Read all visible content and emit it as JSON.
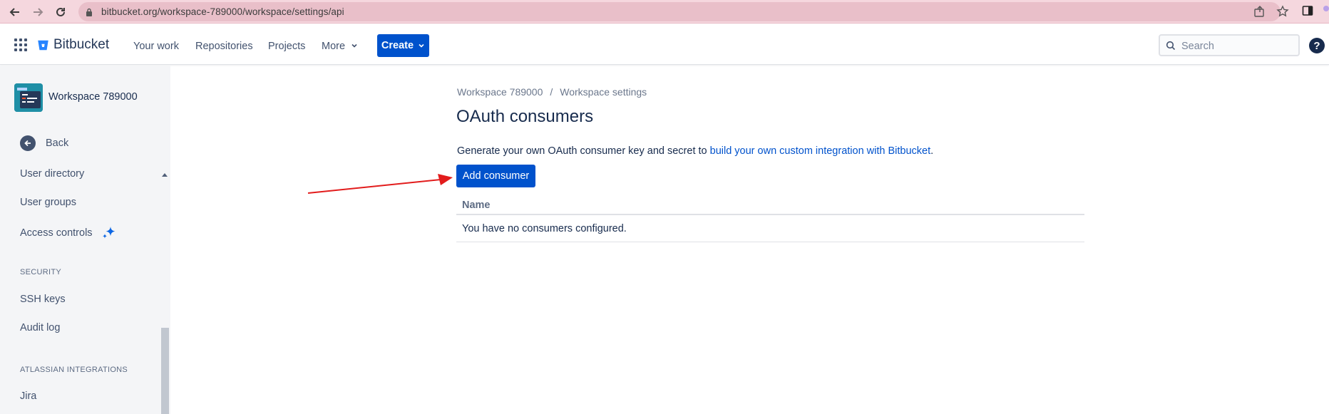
{
  "browser": {
    "url": "bitbucket.org/workspace-789000/workspace/settings/api"
  },
  "header": {
    "brand": "Bitbucket",
    "nav": [
      "Your work",
      "Repositories",
      "Projects",
      "More"
    ],
    "create_label": "Create",
    "search_placeholder": "Search",
    "help_glyph": "?"
  },
  "sidebar": {
    "workspace_name": "Workspace 789000",
    "back_label": "Back",
    "items_top": [
      "User directory",
      "User groups",
      "Access controls"
    ],
    "security_heading": "SECURITY",
    "security_items": [
      "SSH keys",
      "Audit log"
    ],
    "integrations_heading": "ATLASSIAN INTEGRATIONS",
    "integrations_items": [
      "Jira"
    ]
  },
  "main": {
    "breadcrumb": [
      "Workspace 789000",
      "Workspace settings"
    ],
    "breadcrumb_sep": "/",
    "title": "OAuth consumers",
    "desc_prefix": "Generate your own OAuth consumer key and secret to ",
    "desc_link": "build your own custom integration with Bitbucket",
    "desc_suffix": ".",
    "add_button": "Add consumer",
    "table_header": "Name",
    "empty_message": "You have no consumers configured."
  },
  "colors": {
    "accent": "#0052cc",
    "browser_bar": "#f5d7de",
    "annotation_arrow": "#e21c1c"
  }
}
